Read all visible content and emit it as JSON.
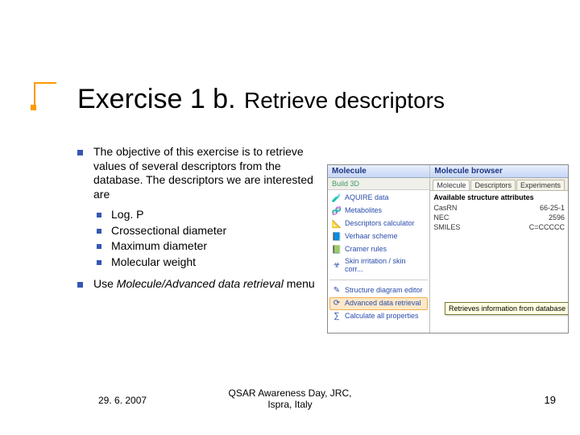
{
  "title": {
    "lead": "Exercise 1 b.",
    "sub": "Retrieve descriptors"
  },
  "body": {
    "objective": "The objective of this exercise is to retrieve values of several descriptors from the database. The descriptors we are interested are",
    "descriptors": [
      "Log. P",
      "Crossectional diameter",
      "Maximum diameter",
      "Molecular weight"
    ],
    "instruction_pre": "Use ",
    "instruction_em": "Molecule/Advanced data retrieval",
    "instruction_post": " menu"
  },
  "shot": {
    "left": {
      "header": "Molecule",
      "subheader": "Build 3D",
      "items": [
        {
          "icon": "🧪",
          "label": "AQUIRE data",
          "selected": false
        },
        {
          "icon": "🧬",
          "label": "Metabolites",
          "selected": false
        },
        {
          "icon": "📐",
          "label": "Descriptors calculator",
          "selected": false
        },
        {
          "icon": "📘",
          "label": "Verhaar scheme",
          "selected": false
        },
        {
          "icon": "📗",
          "label": "Cramer rules",
          "selected": false
        },
        {
          "icon": "☣",
          "label": "Skin irritation / skin corr...",
          "selected": false
        }
      ],
      "items2": [
        {
          "icon": "✎",
          "label": "Structure diagram editor",
          "selected": false
        },
        {
          "icon": "⟳",
          "label": "Advanced data retrieval",
          "selected": true
        },
        {
          "icon": "∑",
          "label": "Calculate all properties",
          "selected": false
        }
      ]
    },
    "right": {
      "header": "Molecule browser",
      "tabs": [
        "Molecule",
        "Descriptors",
        "Experiments"
      ],
      "active_tab": 0,
      "attrs_header": "Available structure attributes",
      "attrs": [
        {
          "k": "CasRN",
          "v": "66-25-1"
        },
        {
          "k": "NEC",
          "v": "2596"
        },
        {
          "k": "SMILES",
          "v": "C=CCCCC"
        }
      ]
    },
    "tooltip": "Retrieves information from database for the current structure(s)"
  },
  "footer": {
    "date": "29. 6. 2007",
    "center_line1": "QSAR Awareness Day, JRC,",
    "center_line2": "Ispra, Italy",
    "page": "19"
  }
}
